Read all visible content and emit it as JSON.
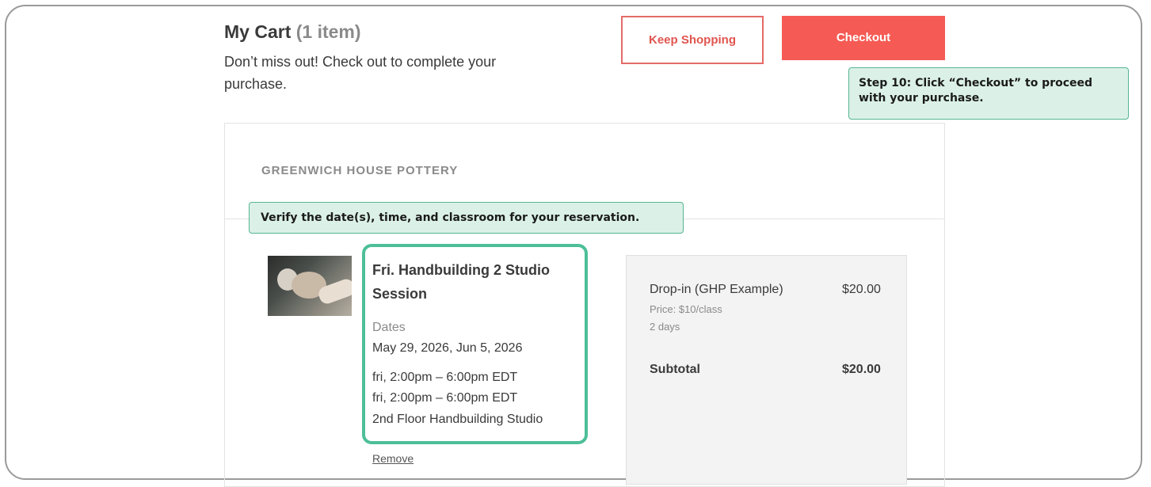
{
  "cart": {
    "title": "My Cart",
    "count": "(1 item)",
    "subtitle": "Don’t miss out! Check out to complete your purchase."
  },
  "buttons": {
    "keep_shopping": "Keep Shopping",
    "checkout": "Checkout"
  },
  "tips": {
    "step10": "Step 10: Click “Checkout” to proceed with your purchase.",
    "verify": "Verify the date(s), time, and classroom for your reservation."
  },
  "org_name": "GREENWICH HOUSE POTTERY",
  "item": {
    "image_icon": "pottery-photo",
    "title": "Fri. Handbuilding 2 Studio Session",
    "dates_label": "Dates",
    "dates_value": "May 29, 2026, Jun 5, 2026",
    "times": [
      "fri, 2:00pm – 6:00pm EDT",
      "fri, 2:00pm – 6:00pm EDT"
    ],
    "room": "2nd Floor Handbuilding Studio",
    "remove_label": "Remove"
  },
  "summary": {
    "item_name": "Drop-in (GHP Example)",
    "item_price": "$20.00",
    "price_note": "Price: $10/class",
    "days_note": "2 days",
    "subtotal_label": "Subtotal",
    "subtotal_value": "$20.00"
  },
  "colors": {
    "accent": "#f55a54",
    "highlight": "#4dbf98",
    "tip_bg": "#dbf1e8"
  }
}
